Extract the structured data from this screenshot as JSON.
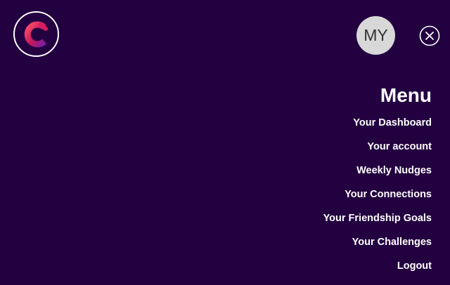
{
  "header": {
    "logo_icon": "brand-c-logo-icon",
    "avatar_initials": "MY",
    "close_icon": "close-circle-x-icon"
  },
  "menu": {
    "title": "Menu",
    "items": [
      {
        "label": "Your Dashboard"
      },
      {
        "label": "Your account"
      },
      {
        "label": "Weekly Nudges"
      },
      {
        "label": "Your Connections"
      },
      {
        "label": "Your Friendship Goals"
      },
      {
        "label": "Your Challenges"
      },
      {
        "label": "Logout"
      }
    ]
  },
  "colors": {
    "background": "#230040",
    "text": "#ffffff",
    "avatar_bg": "#d8d8d8",
    "logo_gradient_start": "#ff4d6d",
    "logo_gradient_end": "#8a2be2"
  }
}
